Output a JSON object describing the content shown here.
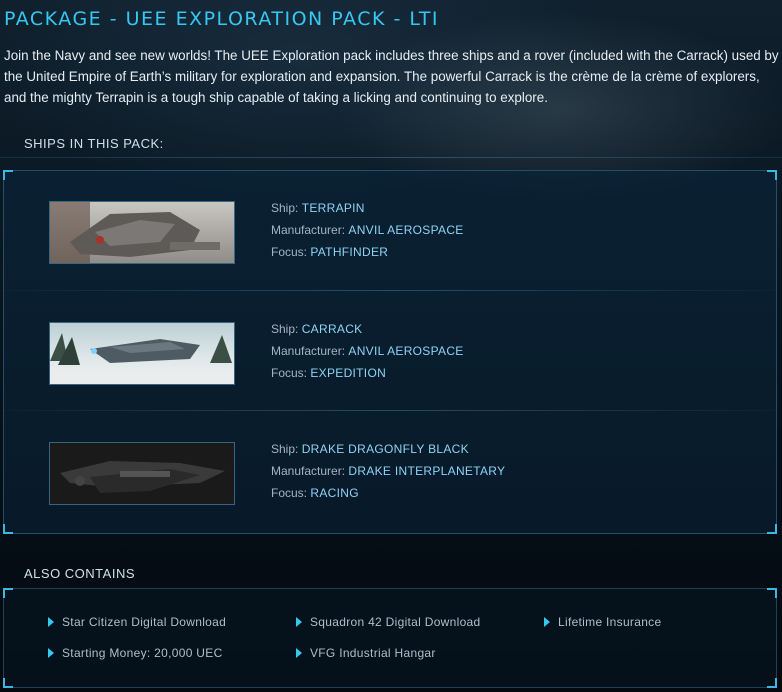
{
  "package": {
    "title": "PACKAGE - UEE EXPLORATION PACK - LTI",
    "description": "Join the Navy and see new worlds! The UEE Exploration pack includes three ships and a rover (included with the Carrack) used by the United Empire of Earth’s military for exploration and expansion. The powerful Carrack is the crème de la crème of explorers, and the mighty Terrapin is a tough ship capable of taking a licking and continuing to explore."
  },
  "ships_section": {
    "label": "SHIPS IN THIS PACK:",
    "field_labels": {
      "ship": "Ship:",
      "manufacturer": "Manufacturer:",
      "focus": "Focus:"
    },
    "ships": [
      {
        "name": "TERRAPIN",
        "manufacturer": "ANVIL AEROSPACE",
        "focus": "PATHFINDER"
      },
      {
        "name": "CARRACK",
        "manufacturer": "ANVIL AEROSPACE",
        "focus": "EXPEDITION"
      },
      {
        "name": "DRAKE DRAGONFLY BLACK",
        "manufacturer": "DRAKE INTERPLANETARY",
        "focus": "RACING"
      }
    ]
  },
  "also_section": {
    "label": "ALSO CONTAINS",
    "items": [
      "Star Citizen Digital Download",
      "Squadron 42 Digital Download",
      "Lifetime Insurance",
      "Starting Money: 20,000 UEC",
      "VFG Industrial Hangar"
    ]
  },
  "colors": {
    "title": "#36c8f2",
    "value": "#8fd3f5",
    "panel_border": "#3fb6e0"
  }
}
